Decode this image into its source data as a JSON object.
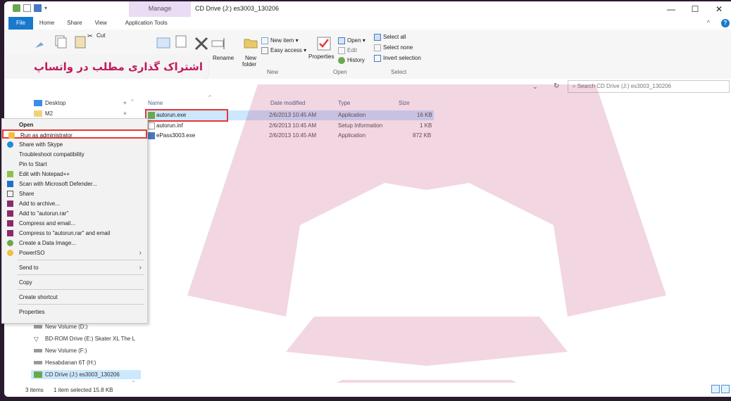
{
  "colors": {
    "accent": "#1979ca",
    "watermark": "#b0004a",
    "banner_text": "#c2185b",
    "selection": "#cce8ff",
    "highlight_box": "#e53935"
  },
  "window": {
    "title": "CD Drive (J:) es3003_130206",
    "manage_label": "Manage",
    "minimize": "—",
    "maximize": "☐",
    "close": "✕"
  },
  "tabs": [
    "File",
    "Home",
    "Share",
    "View",
    "Application Tools"
  ],
  "ribbon": {
    "cut": "Cut",
    "rename": "Rename",
    "new_folder_1": "New",
    "new_folder_2": "folder",
    "new_item": "New item ▾",
    "easy_access": "Easy access ▾",
    "group_new": "New",
    "properties": "Properties",
    "open": "Open ▾",
    "edit": "Edit",
    "history": "History",
    "group_open": "Open",
    "select_all": "Select all",
    "select_none": "Select none",
    "invert_selection": "Invert selection",
    "group_select": "Select",
    "partial_rename": "e"
  },
  "banner": "اشتراک گذاری مطلب در واتساپ",
  "search_placeholder": "Search CD Drive (J:) es3003_130206",
  "nav": {
    "items_top": [
      "Desktop",
      "M2"
    ],
    "items_bottom": [
      "New Volume (D:)",
      "BD-ROM Drive (E:) Skater XL The L",
      "New Volume (F:)",
      "Hesabdanan 6T (H:)",
      "CD Drive (J:) es3003_130206"
    ]
  },
  "columns": {
    "name": "Name",
    "date": "Date modified",
    "type": "Type",
    "size": "Size"
  },
  "files": [
    {
      "name": "autorun.exe",
      "date": "2/6/2013 10:45 AM",
      "type": "Application",
      "size": "16 KB"
    },
    {
      "name": "autorun.inf",
      "date": "2/6/2013 10:45 AM",
      "type": "Setup Information",
      "size": "1 KB"
    },
    {
      "name": "ePass3003.exe",
      "date": "2/6/2013 10:45 AM",
      "type": "Application",
      "size": "872 KB"
    }
  ],
  "context_menu": {
    "open": "Open",
    "run_as_admin": "Run as administrator",
    "share_skype": "Share with Skype",
    "troubleshoot": "Troubleshoot compatibility",
    "pin_start": "Pin to Start",
    "edit_notepad": "Edit with Notepad++",
    "scan_defender": "Scan with Microsoft Defender...",
    "share": "Share",
    "add_archive": "Add to archive...",
    "add_rar": "Add to \"autorun.rar\"",
    "compress_email": "Compress and email...",
    "compress_rar_email": "Compress to \"autorun.rar\" and email",
    "create_data_image": "Create a Data Image...",
    "poweriso": "PowerISO",
    "send_to": "Send to",
    "copy": "Copy",
    "create_shortcut": "Create shortcut",
    "properties": "Properties"
  },
  "status": {
    "items": "3 items",
    "selected": "1 item selected  15.8 KB"
  }
}
